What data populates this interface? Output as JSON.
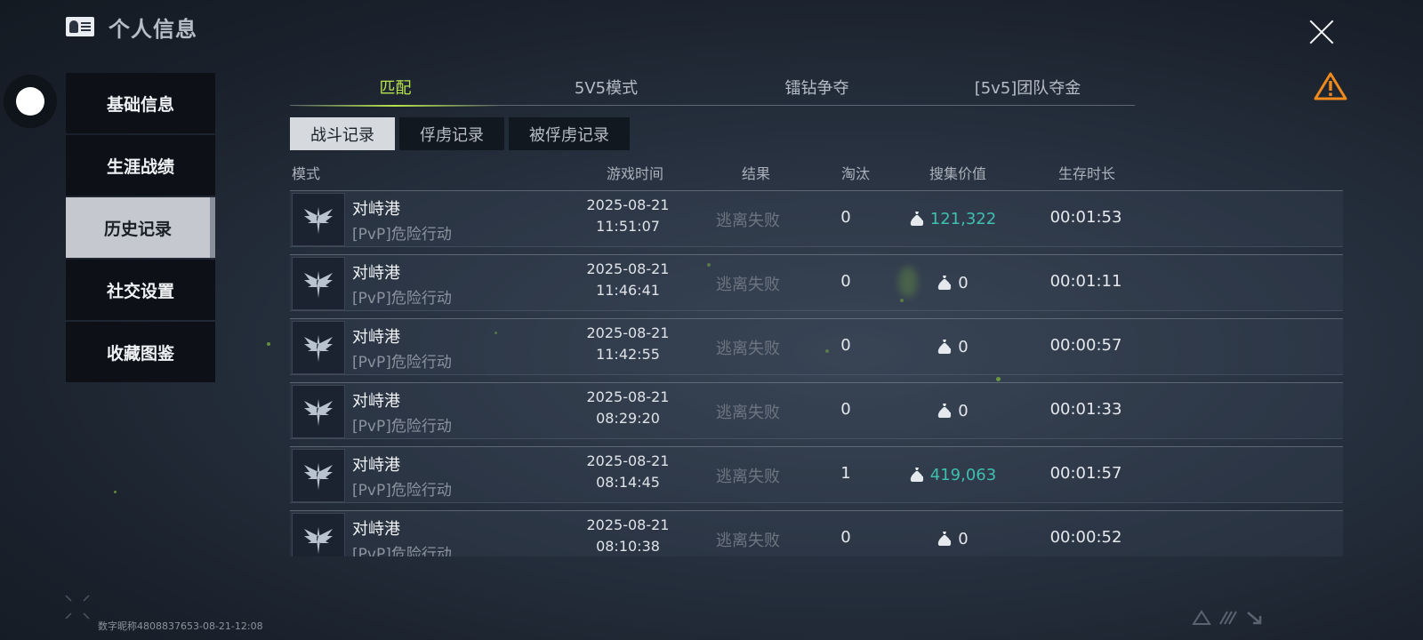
{
  "header": {
    "title": "个人信息",
    "title_icon": "id-card-icon",
    "close_icon": "close-icon",
    "warning_icon": "warning-triangle-icon"
  },
  "sidebar": {
    "items": [
      {
        "label": "基础信息",
        "active": false
      },
      {
        "label": "生涯战绩",
        "active": false
      },
      {
        "label": "历史记录",
        "active": true
      },
      {
        "label": "社交设置",
        "active": false
      },
      {
        "label": "收藏图鉴",
        "active": false
      }
    ]
  },
  "mode_tabs": [
    {
      "label": "匹配",
      "active": true
    },
    {
      "label": "5V5模式",
      "active": false
    },
    {
      "label": "镭钻争夺",
      "active": false
    },
    {
      "label": "[5v5]团队夺金",
      "active": false
    }
  ],
  "sub_tabs": [
    {
      "label": "战斗记录",
      "active": true
    },
    {
      "label": "俘虏记录",
      "active": false
    },
    {
      "label": "被俘虏记录",
      "active": false
    }
  ],
  "columns": {
    "mode": "模式",
    "game_time": "游戏时间",
    "result": "结果",
    "eliminations": "淘汰",
    "loot_value": "搜集价值",
    "survival": "生存时长"
  },
  "records": [
    {
      "map": "对峙港",
      "mode": "[PvP]危险行动",
      "date": "2025-08-21",
      "time": "11:51:07",
      "result": "逃离失败",
      "eliminations": "0",
      "loot": "121,322",
      "loot_highlight": true,
      "survival": "00:01:53"
    },
    {
      "map": "对峙港",
      "mode": "[PvP]危险行动",
      "date": "2025-08-21",
      "time": "11:46:41",
      "result": "逃离失败",
      "eliminations": "0",
      "loot": "0",
      "loot_highlight": false,
      "survival": "00:01:11"
    },
    {
      "map": "对峙港",
      "mode": "[PvP]危险行动",
      "date": "2025-08-21",
      "time": "11:42:55",
      "result": "逃离失败",
      "eliminations": "0",
      "loot": "0",
      "loot_highlight": false,
      "survival": "00:00:57"
    },
    {
      "map": "对峙港",
      "mode": "[PvP]危险行动",
      "date": "2025-08-21",
      "time": "08:29:20",
      "result": "逃离失败",
      "eliminations": "0",
      "loot": "0",
      "loot_highlight": false,
      "survival": "00:01:33"
    },
    {
      "map": "对峙港",
      "mode": "[PvP]危险行动",
      "date": "2025-08-21",
      "time": "08:14:45",
      "result": "逃离失败",
      "eliminations": "1",
      "loot": "419,063",
      "loot_highlight": true,
      "survival": "00:01:57"
    },
    {
      "map": "对峙港",
      "mode": "[PvP]危险行动",
      "date": "2025-08-21",
      "time": "08:10:38",
      "result": "逃离失败",
      "eliminations": "0",
      "loot": "0",
      "loot_highlight": false,
      "survival": "00:00:52"
    }
  ],
  "footer": {
    "watermark": "数字昵称4808837653-08-21-12:08"
  },
  "colors": {
    "accent_green": "#b7e34c",
    "loot_teal": "#3fbfb0",
    "warning_orange": "#f08a1c"
  }
}
